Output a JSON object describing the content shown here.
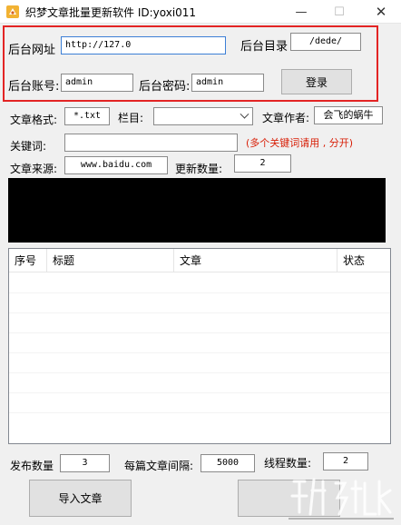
{
  "window": {
    "title": "织梦文章批量更新软件   ID:yoxi011",
    "minimize": "—",
    "maximize": "☐",
    "close": "✕"
  },
  "login": {
    "url_label": "后台网址",
    "url_value": "http://127.0",
    "dir_label": "后台目录",
    "dir_value": "/dede/",
    "account_label": "后台账号:",
    "account_value": "admin",
    "password_label": "后台密码:",
    "password_value": "admin",
    "login_button": "登录"
  },
  "article": {
    "format_label": "文章格式:",
    "format_value": "*.txt",
    "column_label": "栏目:",
    "column_value": "",
    "author_label": "文章作者:",
    "author_value": "会飞的蜗牛",
    "keyword_label": "关键词:",
    "keyword_value": "",
    "keyword_hint": "(多个关键词请用 , 分开)",
    "source_label": "文章来源:",
    "source_value": "www.baidu.com",
    "update_count_label": "更新数量:",
    "update_count_value": "2"
  },
  "table": {
    "columns": [
      "序号",
      "标题",
      "文章",
      "状态"
    ]
  },
  "bottom": {
    "publish_count_label": "发布数量",
    "publish_count_value": "3",
    "interval_label": "每篇文章间隔:",
    "interval_value": "5000",
    "thread_label": "线程数量:",
    "thread_value": "2",
    "import_button": "导入文章"
  }
}
